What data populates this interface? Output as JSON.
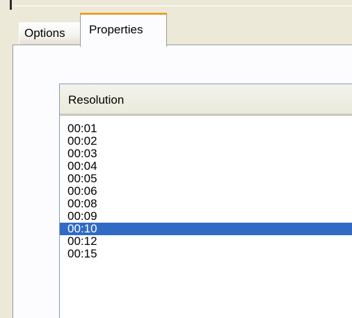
{
  "tabs": [
    {
      "label": "Options",
      "active": false
    },
    {
      "label": "Properties",
      "active": true
    }
  ],
  "list": {
    "column_header": "Resolution",
    "items": [
      "00:01",
      "00:02",
      "00:03",
      "00:04",
      "00:05",
      "00:06",
      "00:08",
      "00:09",
      "00:10",
      "00:12",
      "00:15"
    ],
    "selected_index": 8
  },
  "colors": {
    "selection": "#316ac5",
    "active_tab_accent": "#e68b2c",
    "window_background": "#ece9d8"
  }
}
